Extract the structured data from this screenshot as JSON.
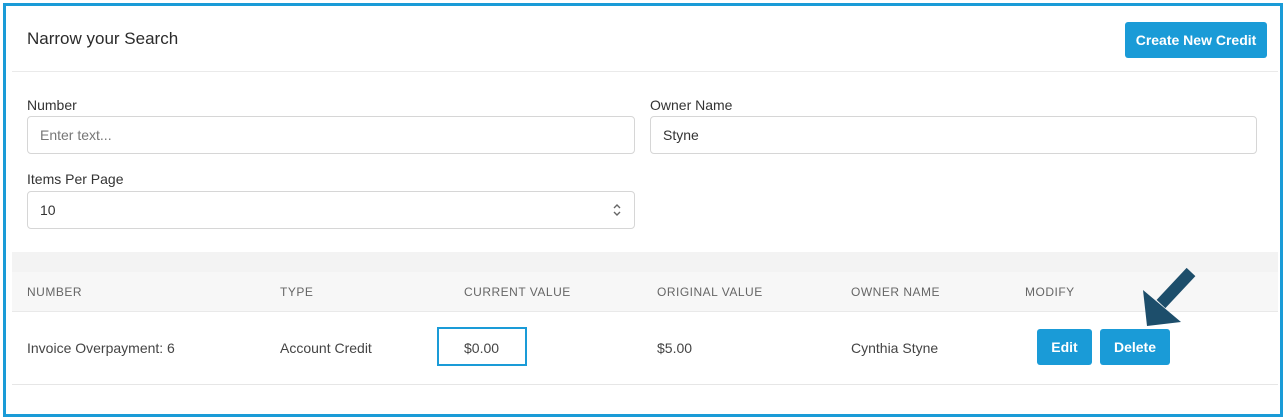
{
  "search": {
    "title": "Narrow your Search",
    "create_button": "Create New Credit",
    "number_label": "Number",
    "number_placeholder": "Enter text...",
    "owner_label": "Owner Name",
    "owner_value": "Styne",
    "items_label": "Items Per Page",
    "items_value": "10"
  },
  "table": {
    "headers": [
      "NUMBER",
      "TYPE",
      "CURRENT VALUE",
      "ORIGINAL VALUE",
      "OWNER NAME",
      "MODIFY"
    ],
    "rows": [
      {
        "number": "Invoice Overpayment: 6",
        "type": "Account Credit",
        "current_value": "$0.00",
        "original_value": "$5.00",
        "owner_name": "Cynthia Styne",
        "edit_label": "Edit",
        "delete_label": "Delete"
      }
    ]
  },
  "colors": {
    "accent": "#1a9bd7",
    "arrow": "#1d4e6b"
  },
  "icons": {
    "select_chevron": "chevron-up-down-icon",
    "annotation_arrow": "arrow-down-left-icon"
  }
}
